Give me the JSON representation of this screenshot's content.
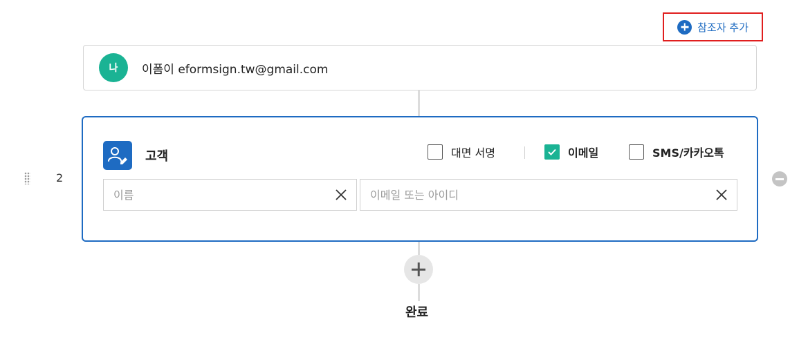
{
  "header": {
    "add_cc_label": "참조자 추가"
  },
  "sender": {
    "avatar_text": "나",
    "display": "이폼이 eformsign.tw@gmail.com"
  },
  "step": {
    "number": "2",
    "role_label": "고객",
    "options": [
      {
        "label": "대면 서명",
        "checked": false
      },
      {
        "label": "이메일",
        "checked": true
      },
      {
        "label": "SMS/카카오톡",
        "checked": false
      }
    ],
    "name_placeholder": "이름",
    "email_placeholder": "이메일 또는 아이디"
  },
  "footer": {
    "complete_label": "완료"
  },
  "colors": {
    "accent": "#1e6bc2",
    "checkbox_checked": "#1ab394",
    "avatar": "#1ab394",
    "highlight_border": "#e01e1e"
  },
  "icons": {
    "add_cc": "plus-circle-icon",
    "role": "user-edit-icon",
    "clear": "close-icon",
    "remove": "minus-circle-icon",
    "add_step": "plus-icon",
    "drag": "drag-handle-icon"
  }
}
